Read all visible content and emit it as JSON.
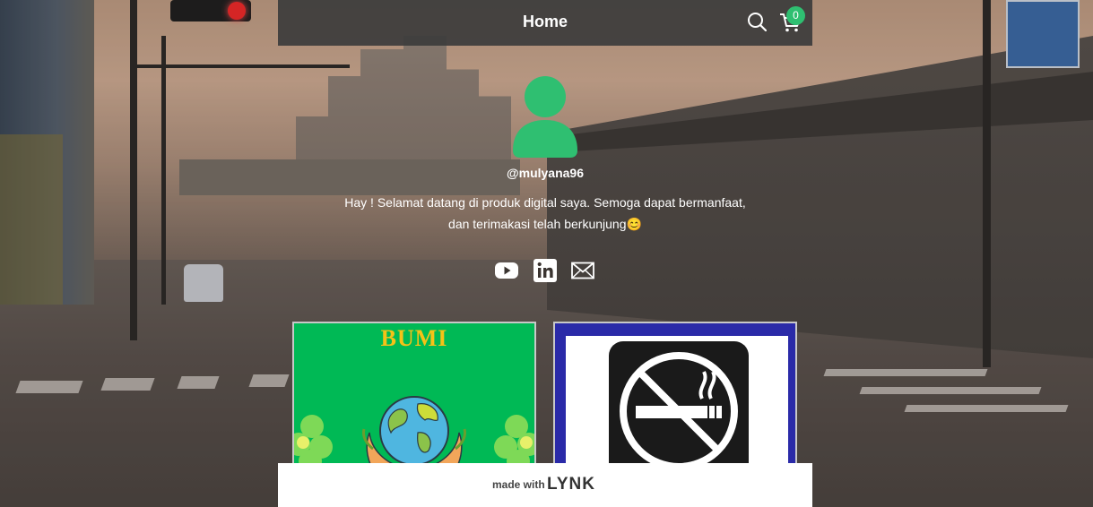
{
  "header": {
    "title": "Home",
    "cart_count": "0"
  },
  "profile": {
    "username": "@mulyana96",
    "bio_line1": "Hay ! Selamat datang di produk digital saya. Semoga dapat bermanfaat,",
    "bio_line2": "dan terimakasi telah berkunjung😊"
  },
  "socials": [
    {
      "name": "youtube-icon"
    },
    {
      "name": "linkedin-icon"
    },
    {
      "name": "mail-icon"
    }
  ],
  "products": [
    {
      "label": "BUMI"
    },
    {
      "label": ""
    }
  ],
  "footer": {
    "made_with": "made with",
    "brand": "LYNK"
  },
  "colors": {
    "accent": "#2fbf71",
    "header_bg": "#3c3c3c",
    "card1_bg": "#00b955",
    "card2_bg": "#2a2aa8",
    "bumi_text": "#f5c217"
  }
}
